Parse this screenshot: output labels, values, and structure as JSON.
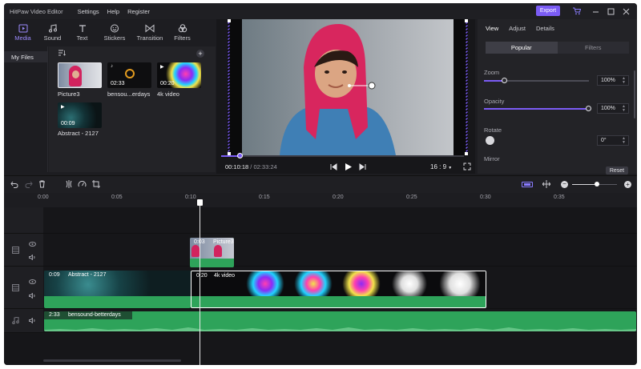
{
  "app": {
    "title": "HitPaw Video Editor"
  },
  "menu": [
    "Settings",
    "Help",
    "Register"
  ],
  "export_label": "Export",
  "media_tabs": [
    {
      "label": "Media",
      "icon": "media-icon",
      "active": true
    },
    {
      "label": "Sound",
      "icon": "music-note-icon"
    },
    {
      "label": "Text",
      "icon": "text-icon"
    },
    {
      "label": "Stickers",
      "icon": "smiley-icon"
    },
    {
      "label": "Transition",
      "icon": "bowtie-icon"
    },
    {
      "label": "Filters",
      "icon": "filters-icon"
    }
  ],
  "left_nav": {
    "my_files": "My Files"
  },
  "library": {
    "items": [
      {
        "label": "Picture3",
        "type": "image"
      },
      {
        "label": "bensou...erdays",
        "duration": "02:33",
        "type": "audio"
      },
      {
        "label": "4k video",
        "duration": "00:20",
        "type": "video"
      },
      {
        "label": "Abstract - 2127",
        "duration": "00:09",
        "type": "video"
      }
    ]
  },
  "preview": {
    "current_time": "00:10:18",
    "separator": " / ",
    "total_time": "02:33:24",
    "aspect_ratio": "16 : 9",
    "progress_fraction": 0.08
  },
  "properties": {
    "tabs": [
      "View",
      "Adjust",
      "Details"
    ],
    "segments": [
      "Popular",
      "Filters"
    ],
    "zoom": {
      "label": "Zoom",
      "value": "100%",
      "fraction": 0.2
    },
    "opacity": {
      "label": "Opacity",
      "value": "100%",
      "fraction": 1.0
    },
    "rotate": {
      "label": "Rotate",
      "value": "0°"
    },
    "mirror": {
      "label": "Mirror"
    },
    "reset_label": "Reset"
  },
  "timeline": {
    "ticks": [
      "0:00",
      "0:05",
      "0:10",
      "0:15",
      "0:20",
      "0:25",
      "0:30",
      "0:35"
    ],
    "clips": {
      "picture": {
        "duration": "0:03",
        "label": "Picture3"
      },
      "abstract": {
        "duration": "0:09",
        "label": "Abstract - 2127"
      },
      "video": {
        "duration": "0:20",
        "label": "4k video"
      },
      "audio": {
        "duration": "2:33",
        "label": "bensound-betterdays"
      }
    }
  },
  "colors": {
    "accent": "#7b5cf5",
    "track_green": "#2ea35a",
    "background": "#1d1d21"
  }
}
